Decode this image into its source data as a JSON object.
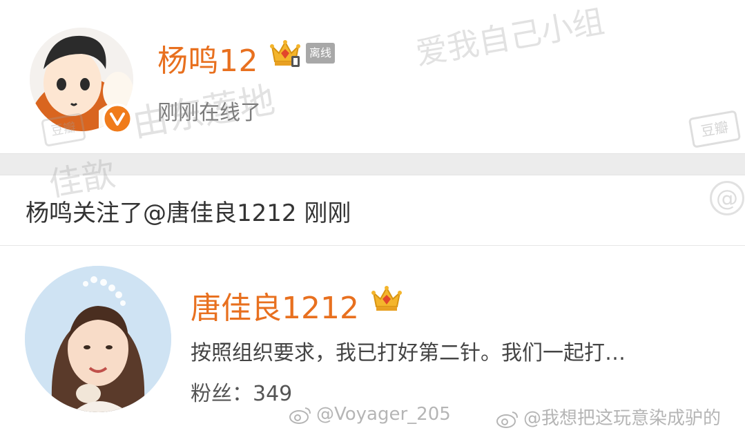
{
  "post": {
    "user1": {
      "name": "杨鸣12",
      "badge_offline": "离线",
      "status": "刚刚在线了"
    },
    "activity": "杨鸣关注了@唐佳良1212 刚刚",
    "user2": {
      "name": "唐佳良1212",
      "bio": "按照组织要求，我已打好第二针。我们一起打…",
      "fans_label": "粉丝：",
      "fans_count": "349"
    }
  },
  "watermarks": {
    "top_right": "爱我自己小组",
    "middle_left": "佳歆",
    "middle_center": "由东莲地",
    "douban_box": "豆瓣",
    "at_symbol": "@",
    "credit1": "@Voyager_205",
    "credit2": "@我想把这玩意染成驴的"
  },
  "colors": {
    "name_orange": "#e8701f",
    "vip_gold": "#f4b52c",
    "verified_orange": "#f07b1a",
    "offline_gray": "#a8a8a8"
  },
  "icons": [
    "crown-vip-icon",
    "verified-v-icon",
    "weibo-logo-icon"
  ]
}
